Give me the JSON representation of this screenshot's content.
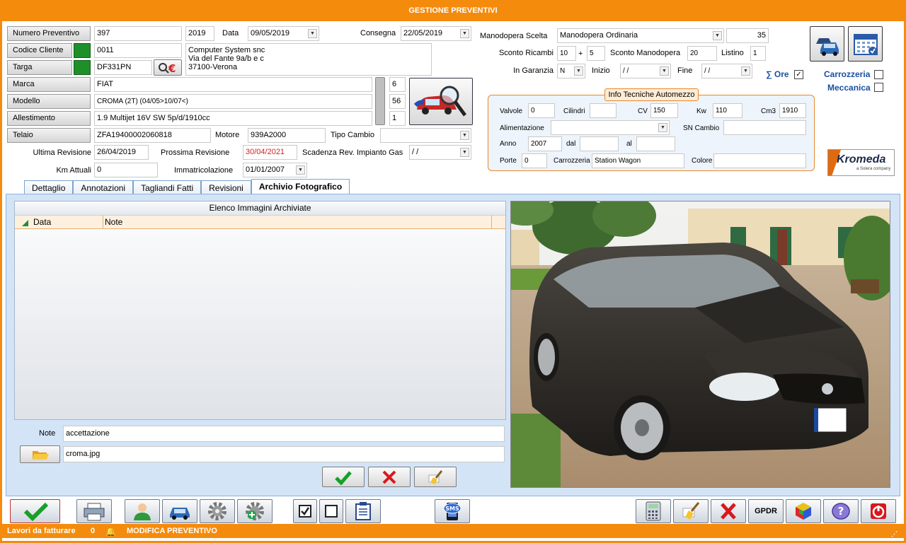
{
  "window": {
    "title": "GESTIONE PREVENTIVI"
  },
  "header": {
    "numero_preventivo": {
      "label": "Numero Preventivo",
      "value": "397",
      "year": "2019"
    },
    "data": {
      "label": "Data",
      "value": "09/05/2019"
    },
    "consegna": {
      "label": "Consegna",
      "value": "22/05/2019"
    },
    "codice_cliente": {
      "label": "Codice Cliente",
      "value": "0011"
    },
    "cliente": {
      "line1": "Computer System snc",
      "line2": "Via del Fante 9a/b e c",
      "line3": "37100-Verona"
    },
    "targa": {
      "label": "Targa",
      "value": "DF331PN"
    },
    "marca": {
      "label": "Marca",
      "value": "FIAT",
      "code": "6"
    },
    "modello": {
      "label": "Modello",
      "value": "CROMA (2T) (04/05>10/07<)",
      "code": "56"
    },
    "allestimento": {
      "label": "Allestimento",
      "value": "1.9 Multijet 16V SW 5p/d/1910cc",
      "code": "1"
    },
    "telaio": {
      "label": "Telaio",
      "value": "ZFA19400002060818"
    },
    "motore": {
      "label": "Motore",
      "value": "939A2000"
    },
    "tipo_cambio": {
      "label": "Tipo Cambio",
      "value": ""
    },
    "ultima_revisione": {
      "label": "Ultima Revisione",
      "value": "26/04/2019"
    },
    "prossima_revisione": {
      "label": "Prossima Revisione",
      "value": "30/04/2021"
    },
    "scadenza_gas": {
      "label": "Scadenza Rev. Impianto Gas",
      "value": "  /  /"
    },
    "km_attuali": {
      "label": "Km Attuali",
      "value": "0"
    },
    "immatricolazione": {
      "label": "Immatricolazione",
      "value": "01/01/2007"
    }
  },
  "right": {
    "manodopera_scelta": {
      "label": "Manodopera Scelta",
      "value": "Manodopera Ordinaria",
      "amount": "35"
    },
    "sconto_ricambi": {
      "label": "Sconto Ricambi",
      "v1": "10",
      "plus": "+",
      "v2": "5"
    },
    "sconto_manodopera": {
      "label": "Sconto Manodopera",
      "value": "20"
    },
    "listino": {
      "label": "Listino",
      "value": "1"
    },
    "in_garanzia": {
      "label": "In Garanzia",
      "value": "N"
    },
    "inizio": {
      "label": "Inizio",
      "value": "  /  /"
    },
    "fine": {
      "label": "Fine",
      "value": "  /  /"
    },
    "ore": {
      "label": "∑ Ore",
      "checked": "✓"
    },
    "carrozzeria": {
      "label": "Carrozzeria"
    },
    "meccanica": {
      "label": "Meccanica"
    },
    "kromeda": {
      "brand": "Kromeda",
      "tagline": "a Solera company"
    }
  },
  "info_tecniche": {
    "title": "Info Tecniche Automezzo",
    "valvole": {
      "label": "Valvole",
      "value": "0"
    },
    "cilindri": {
      "label": "Cilindri",
      "value": ""
    },
    "cv": {
      "label": "CV",
      "value": "150"
    },
    "kw": {
      "label": "Kw",
      "value": "110"
    },
    "cm3": {
      "label": "Cm3",
      "value": "1910"
    },
    "alimentazione": {
      "label": "Alimentazione",
      "value": ""
    },
    "sn_cambio": {
      "label": "SN Cambio",
      "value": ""
    },
    "anno": {
      "label": "Anno",
      "value": "2007"
    },
    "dal": {
      "label": "dal",
      "value": ""
    },
    "al": {
      "label": "al",
      "value": ""
    },
    "porte": {
      "label": "Porte",
      "value": "0"
    },
    "carrozzeria": {
      "label": "Carrozzeria",
      "value": "Station Wagon"
    },
    "colore": {
      "label": "Colore",
      "value": ""
    }
  },
  "tabs": [
    {
      "label": "Dettaglio"
    },
    {
      "label": "Annotazioni"
    },
    {
      "label": "Tagliandi Fatti"
    },
    {
      "label": "Revisioni"
    },
    {
      "label": "Archivio Fotografico",
      "active": true
    }
  ],
  "archive": {
    "title": "Elenco Immagini Archiviate",
    "columns": [
      "Data",
      "Note"
    ],
    "note": {
      "label": "Note",
      "value": "accettazione"
    },
    "file": {
      "value": "croma.jpg"
    }
  },
  "status": {
    "lavori": "Lavori da fatturare",
    "count": "0",
    "mode": "MODIFICA PREVENTIVO",
    "gpdr": "GPDR",
    "sms": "SMS"
  },
  "colors": {
    "accent": "#f58b0c",
    "panel": "#d4e4f7",
    "red_date": "#d62020"
  }
}
